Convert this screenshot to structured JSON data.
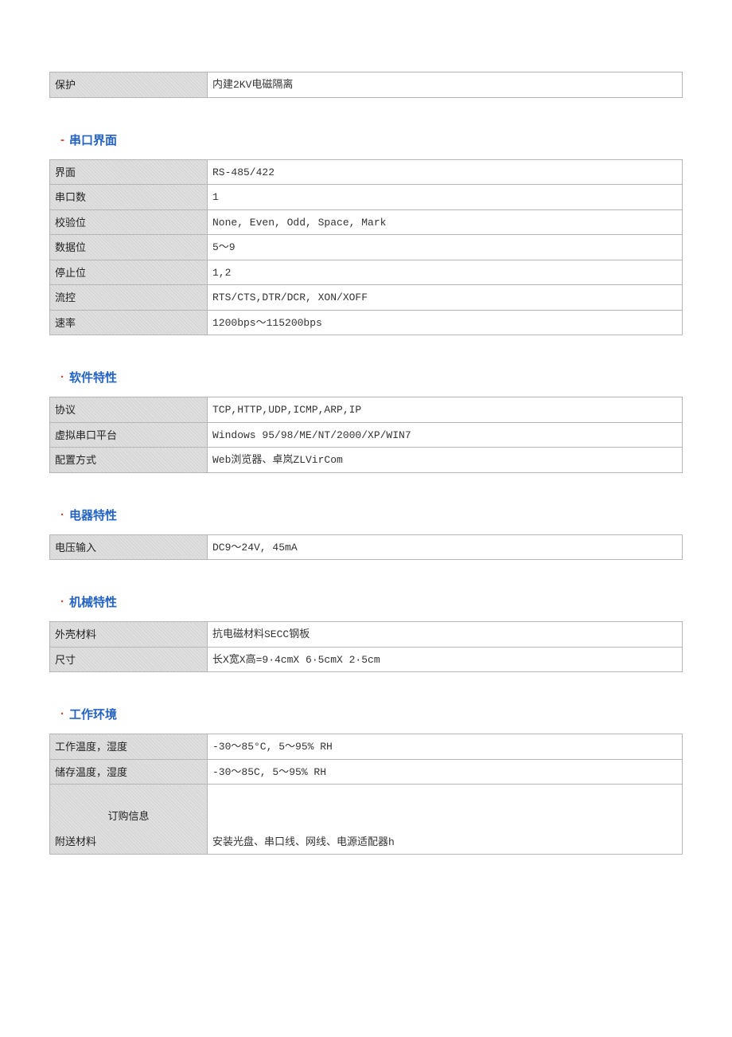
{
  "top_table": {
    "rows": [
      {
        "label": "保护",
        "value": "内建2KV电磁隔离"
      }
    ]
  },
  "sections": [
    {
      "bullet": "-",
      "heading": "串口界面",
      "rows": [
        {
          "label": "界面",
          "value": "RS-485/422"
        },
        {
          "label": "串口数",
          "value": "1"
        },
        {
          "label": "校验位",
          "value": "None, Even, Odd, Space, Mark"
        },
        {
          "label": "数据位",
          "value": "5～9"
        },
        {
          "label": "停止位",
          "value": "1,2"
        },
        {
          "label": "流控",
          "value": "RTS/CTS,DTR/DCR, XON/XOFF"
        },
        {
          "label": "速率",
          "value": "1200bps～115200bps"
        }
      ]
    },
    {
      "bullet": "·",
      "heading": "软件特性",
      "rows": [
        {
          "label": "协议",
          "value": "TCP,HTTP,UDP,ICMP,ARP,IP"
        },
        {
          "label": "虚拟串口平台",
          "value": "Windows 95/98/ME/NT/2000/XP/WIN7"
        },
        {
          "label": "配置方式",
          "value": "Web浏览器、卓岚ZLVirCom"
        }
      ]
    },
    {
      "bullet": "·",
      "heading": "电器特性",
      "rows": [
        {
          "label": "电压输入",
          "value": "DC9～24V, 45mA"
        }
      ]
    },
    {
      "bullet": "·",
      "heading": "机械特性",
      "rows": [
        {
          "label": "外壳材料",
          "value": "抗电磁材料SECC钢板"
        },
        {
          "label": "尺寸",
          "value": "长X宽X高=9·4cmX 6·5cmX 2·5cm"
        }
      ]
    },
    {
      "bullet": "·",
      "heading": "工作环境",
      "rows": [
        {
          "label": "工作温度，湿度",
          "value": "-30～85°C, 5～95% RH"
        },
        {
          "label": "储存温度，湿度",
          "value": "-30～85C, 5～95% RH"
        }
      ],
      "tail_row": {
        "label_top": "订购信息",
        "label_bottom": "附送材料",
        "value": "安装光盘、串口线、网线、电源适配器h"
      }
    }
  ]
}
